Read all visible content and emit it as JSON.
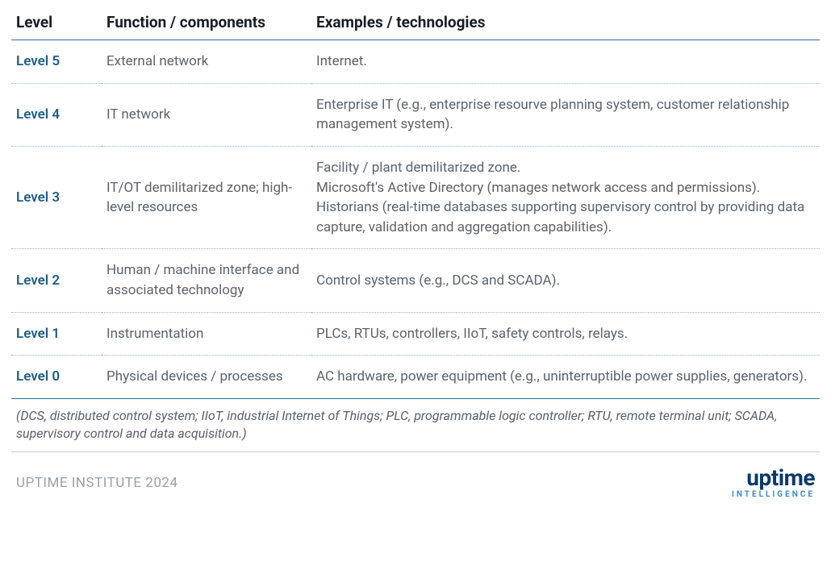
{
  "headers": {
    "level": "Level",
    "function": "Function / components",
    "examples": "Examples / technologies"
  },
  "rows": [
    {
      "level": "Level 5",
      "function": "External network",
      "examples": "Internet."
    },
    {
      "level": "Level 4",
      "function": "IT network",
      "examples": "Enterprise IT (e.g., enterprise resourve planning system, customer relationship management system)."
    },
    {
      "level": "Level 3",
      "function": "IT/OT demilitarized zone; high-level resources",
      "examples": "Facility / plant demilitarized zone.\nMicrosoft's Active Directory (manages network access and permissions).\nHistorians (real-time databases supporting supervisory control by providing data capture, validation and aggregation capabilities)."
    },
    {
      "level": "Level 2",
      "function": "Human / machine interface and associated technology",
      "examples": "Control systems (e.g., DCS and SCADA)."
    },
    {
      "level": "Level 1",
      "function": "Instrumentation",
      "examples": "PLCs, RTUs, controllers, IIoT, safety controls, relays."
    },
    {
      "level": "Level 0",
      "function": "Physical devices / processes",
      "examples": "AC hardware, power equipment (e.g., uninterruptible power supplies, generators)."
    }
  ],
  "footnote": "(DCS, distributed control system; IIoT, industrial Internet of Things; PLC, programmable logic controller; RTU, remote terminal unit; SCADA, supervisory control and data acquisition.)",
  "footer": {
    "copyright": "UPTIME INSTITUTE 2024",
    "logo_top": "uptime",
    "logo_bottom": "INTELLIGENCE"
  }
}
